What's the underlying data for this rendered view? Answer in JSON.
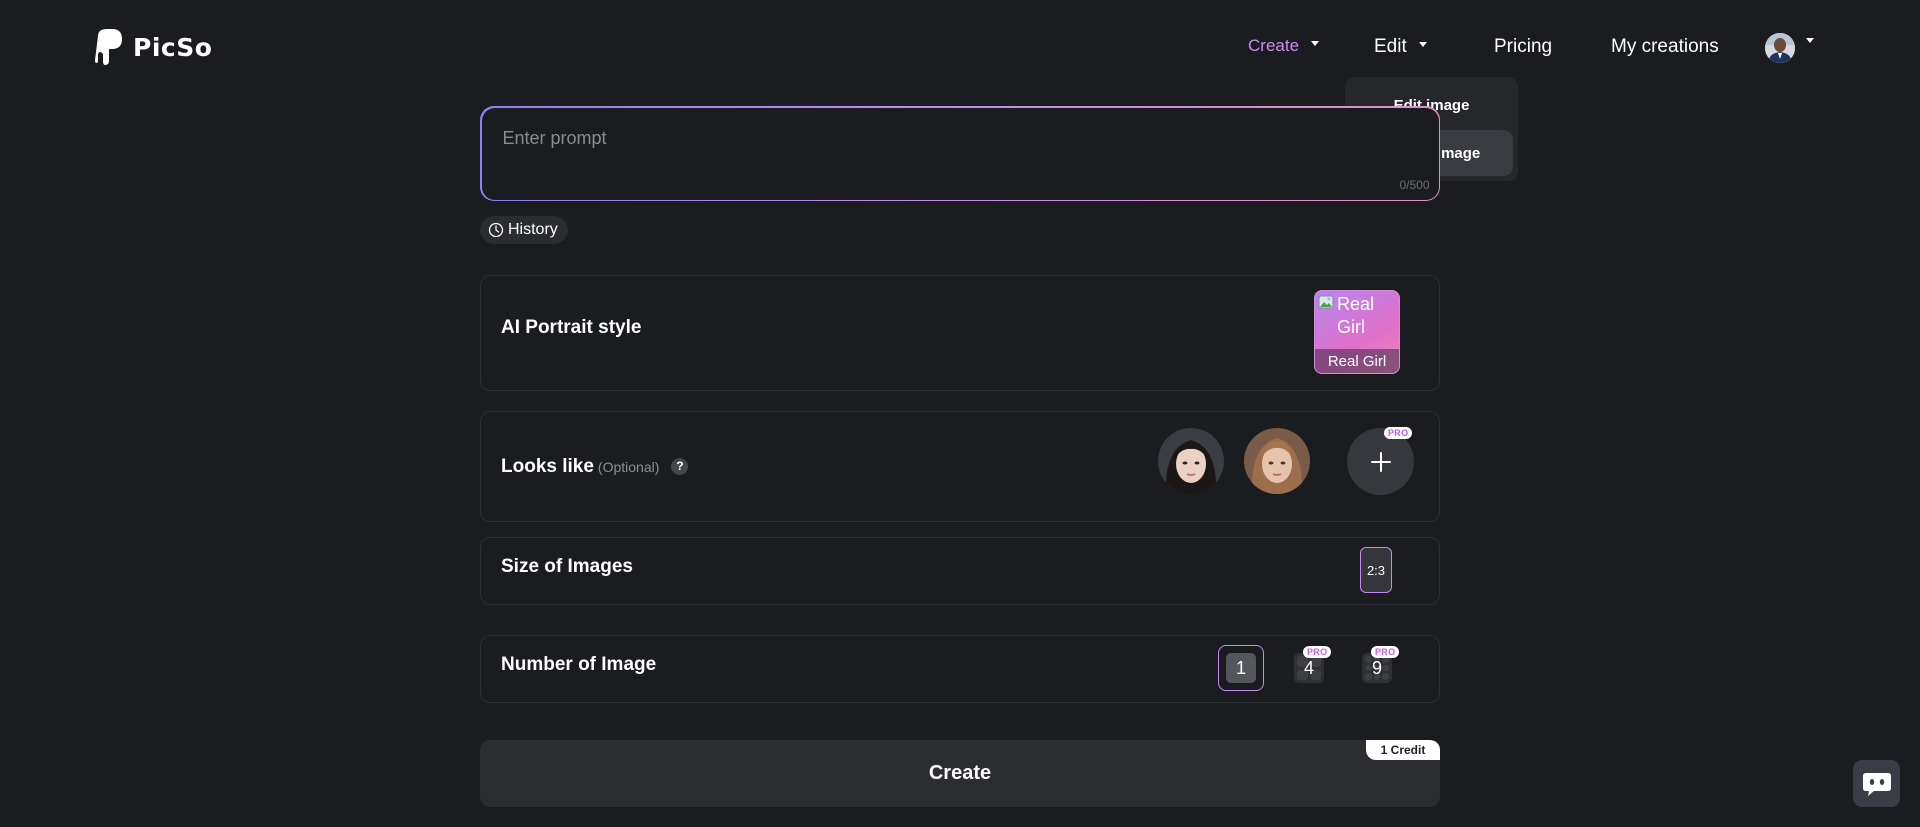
{
  "brand": {
    "name": "PicSo"
  },
  "nav": {
    "create": "Create",
    "edit": "Edit",
    "pricing": "Pricing",
    "my_creations": "My creations",
    "active_color": "#c98bf0"
  },
  "edit_menu": {
    "items": [
      {
        "label": "Edit image"
      },
      {
        "label": "Extend image"
      }
    ]
  },
  "prompt": {
    "placeholder": "Enter prompt",
    "counter": "0/500"
  },
  "history": {
    "label": "History"
  },
  "portrait_style": {
    "title": "AI Portrait style",
    "selected_alt": "Real Girl",
    "selected_caption": "Real Girl"
  },
  "looks_like": {
    "title": "Looks like",
    "optional": "(Optional)",
    "help": "?",
    "pro": "PRO"
  },
  "size": {
    "title": "Size of Images",
    "ratio": "2:3"
  },
  "number": {
    "title": "Number of Image",
    "options": [
      "1",
      "4",
      "9"
    ],
    "pro": "PRO",
    "selected": "1"
  },
  "create_button": {
    "label": "Create",
    "credit": "1 Credit"
  },
  "colors": {
    "background": "#1b1c20",
    "accent_gradient": [
      "#8f7ff0",
      "#c58bf2",
      "#e58fc4"
    ]
  }
}
